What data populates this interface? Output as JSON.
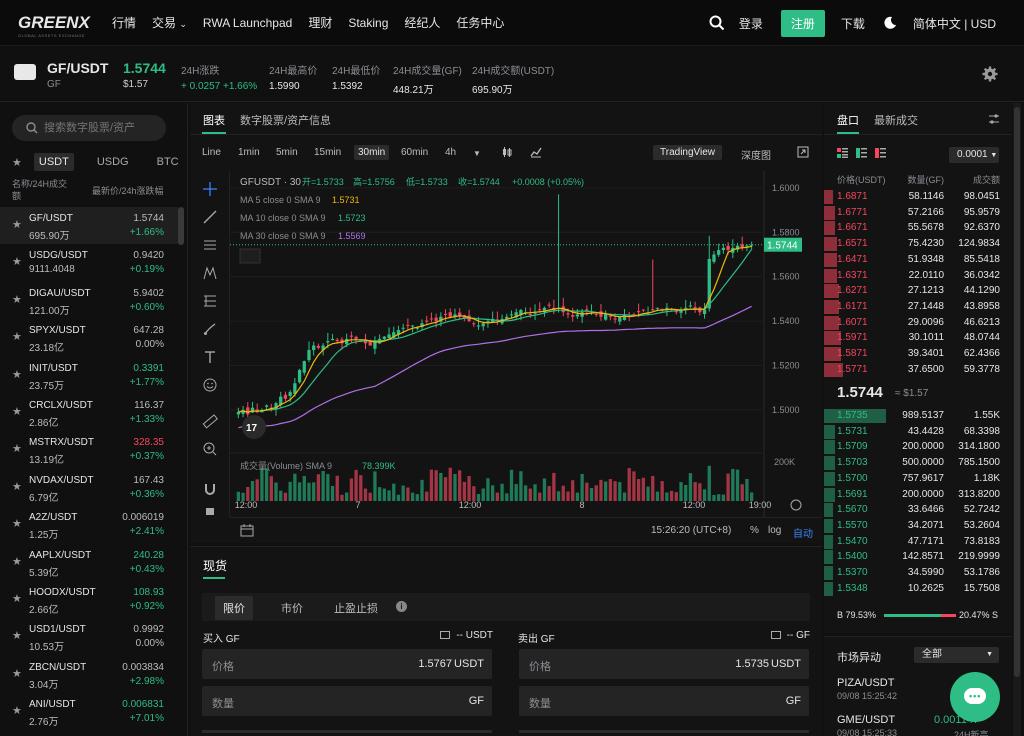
{
  "nav": {
    "logo": "GREENX",
    "logo_sub": "GLOBAL ASSETS EXCHANGE",
    "items": [
      "行情",
      "交易",
      "RWA Launchpad",
      "理财",
      "Staking",
      "经纪人",
      "任务中心"
    ],
    "login": "登录",
    "register": "注册",
    "download": "下载",
    "language": "简体中文 | USD"
  },
  "ticker": {
    "pair": "GF/USDT",
    "base": "GF",
    "last_price": "1.5744",
    "last_usd": "$1.57",
    "stats": [
      {
        "label": "24H涨跌",
        "value": "+ 0.0257 +1.66%",
        "color": "green"
      },
      {
        "label": "24H最高价",
        "value": "1.5990",
        "color": "white"
      },
      {
        "label": "24H最低价",
        "value": "1.5392",
        "color": "white"
      },
      {
        "label": "24H成交量(GF)",
        "value": "448.21万",
        "color": "white"
      },
      {
        "label": "24H成交额(USDT)",
        "value": "695.90万",
        "color": "white"
      }
    ]
  },
  "markets": {
    "search_placeholder": "搜索数字股票/资产",
    "tabs": [
      "USDT",
      "USDG",
      "BTC",
      "L"
    ],
    "head_left": "名称/24H成交额",
    "head_right": "最新价/24h涨跌幅",
    "rows": [
      {
        "symbol": "GF/USDT",
        "volume": "695.90万",
        "price": "1.5744",
        "change": "+1.66%",
        "price_color": "white",
        "change_color": "green"
      },
      {
        "symbol": "USDG/USDT",
        "volume": "9111.4048",
        "price": "0.9420",
        "change": "+0.19%",
        "price_color": "white",
        "change_color": "green"
      },
      {
        "symbol": "DIGAU/USDT",
        "volume": "121.00万",
        "price": "5.9402",
        "change": "+0.60%",
        "price_color": "white",
        "change_color": "green"
      },
      {
        "symbol": "SPYX/USDT",
        "volume": "23.18亿",
        "price": "647.28",
        "change": "0.00%",
        "price_color": "white",
        "change_color": "white"
      },
      {
        "symbol": "INIT/USDT",
        "volume": "23.75万",
        "price": "0.3391",
        "change": "+1.77%",
        "price_color": "green",
        "change_color": "green"
      },
      {
        "symbol": "CRCLX/USDT",
        "volume": "2.86亿",
        "price": "116.37",
        "change": "+1.33%",
        "price_color": "white",
        "change_color": "green"
      },
      {
        "symbol": "MSTRX/USDT",
        "volume": "13.19亿",
        "price": "328.35",
        "change": "+0.37%",
        "price_color": "red",
        "change_color": "green"
      },
      {
        "symbol": "NVDAX/USDT",
        "volume": "6.79亿",
        "price": "167.43",
        "change": "+0.36%",
        "price_color": "white",
        "change_color": "green"
      },
      {
        "symbol": "A2Z/USDT",
        "volume": "1.25万",
        "price": "0.006019",
        "change": "+2.41%",
        "price_color": "white",
        "change_color": "green"
      },
      {
        "symbol": "AAPLX/USDT",
        "volume": "5.39亿",
        "price": "240.28",
        "change": "+0.43%",
        "price_color": "green",
        "change_color": "green"
      },
      {
        "symbol": "HOODX/USDT",
        "volume": "2.66亿",
        "price": "108.93",
        "change": "+0.92%",
        "price_color": "green",
        "change_color": "green"
      },
      {
        "symbol": "USD1/USDT",
        "volume": "10.53万",
        "price": "0.9992",
        "change": "0.00%",
        "price_color": "white",
        "change_color": "white"
      },
      {
        "symbol": "ZBCN/USDT",
        "volume": "3.04万",
        "price": "0.003834",
        "change": "+2.98%",
        "price_color": "white",
        "change_color": "green"
      },
      {
        "symbol": "ANI/USDT",
        "volume": "2.76万",
        "price": "0.006831",
        "change": "+7.01%",
        "price_color": "green",
        "change_color": "green"
      }
    ]
  },
  "chart_tabs": [
    "图表",
    "数字股票/资产信息"
  ],
  "intervals": [
    "Line",
    "1min",
    "5min",
    "15min",
    "30min",
    "60min",
    "4h"
  ],
  "active_interval": "30min",
  "tradingview_label": "TradingView",
  "depth_label": "深度图",
  "chart_data": {
    "type": "candlestick",
    "header": "GFUSDT · 30",
    "ohlc_labels": {
      "open": "开=1.5733",
      "high": "高=1.5756",
      "low": "低=1.5733",
      "close": "收=1.5744",
      "change": "+0.0008 (+0.05%)"
    },
    "indicators": [
      {
        "label": "MA 5 close 0 SMA 9",
        "value": "1.5731",
        "color": "#f0b90b"
      },
      {
        "label": "MA 10 close 0 SMA 9",
        "value": "1.5723",
        "color": "#2ebd85"
      },
      {
        "label": "MA 30 close 0 SMA 9",
        "value": "1.5569",
        "color": "#b070e8"
      }
    ],
    "y_ticks": [
      "1.6000",
      "1.5800",
      "1.5600",
      "1.5400",
      "1.5200",
      "1.5000"
    ],
    "ylim": [
      1.486,
      1.604
    ],
    "price_tag": "1.5744",
    "x_ticks": [
      "12:00",
      "7",
      "12:00",
      "8",
      "12:00",
      "19:00"
    ],
    "volume_label": "成交量(Volume) SMA 9",
    "volume_value": "78.399K",
    "volume_tick": "200K",
    "close_path": [
      1.499,
      1.5,
      1.498,
      1.501,
      1.499,
      1.5,
      1.502,
      1.501,
      1.503,
      1.506,
      1.505,
      1.508,
      1.512,
      1.518,
      1.522,
      1.527,
      1.529,
      1.528,
      1.529,
      1.531,
      1.532,
      1.531,
      1.53,
      1.532,
      1.533,
      1.532,
      1.531,
      1.53,
      1.529,
      1.531,
      1.532,
      1.533,
      1.534,
      1.535,
      1.536,
      1.537,
      1.538,
      1.538,
      1.537,
      1.539,
      1.54,
      1.541,
      1.54,
      1.542,
      1.543,
      1.542,
      1.543,
      1.542,
      1.541,
      1.54,
      1.539,
      1.538,
      1.539,
      1.54,
      1.541,
      1.54,
      1.541,
      1.542,
      1.543,
      1.544,
      1.545,
      1.544,
      1.543,
      1.544,
      1.545,
      1.546,
      1.547,
      1.545,
      1.546,
      1.544,
      1.543,
      1.542,
      1.543,
      1.544,
      1.545,
      1.544,
      1.543,
      1.542,
      1.543,
      1.542,
      1.541,
      1.542,
      1.543,
      1.542,
      1.543,
      1.544,
      1.545,
      1.544,
      1.545,
      1.546,
      1.545,
      1.546,
      1.545,
      1.544,
      1.545,
      1.546,
      1.547,
      1.545,
      1.544,
      1.545,
      1.568,
      1.57,
      1.572,
      1.573,
      1.572,
      1.573,
      1.574,
      1.573,
      1.574,
      1.5744
    ]
  },
  "chart_footer": {
    "time": "15:26:20 (UTC+8)",
    "pct": "%",
    "log": "log",
    "auto": "自动"
  },
  "order": {
    "spot_tab": "现货",
    "types": [
      "限价",
      "市价",
      "止盈止损"
    ],
    "buy_title": "买入 GF",
    "sell_title": "卖出 GF",
    "buy_balance": "-- USDT",
    "sell_balance": "-- GF",
    "price_label": "价格",
    "qty_label": "数量",
    "buy_price": "1.5767",
    "sell_price": "1.5735",
    "price_unit": "USDT",
    "qty_unit": "GF"
  },
  "book": {
    "tabs": [
      "盘口",
      "最新成交"
    ],
    "precision": "0.0001",
    "head": [
      "价格(USDT)",
      "数量(GF)",
      "成交额"
    ],
    "asks": [
      [
        "1.6871",
        "58.1146",
        "98.0451"
      ],
      [
        "1.6771",
        "57.2166",
        "95.9579"
      ],
      [
        "1.6671",
        "55.5678",
        "92.6370"
      ],
      [
        "1.6571",
        "75.4230",
        "124.9834"
      ],
      [
        "1.6471",
        "51.9348",
        "85.5418"
      ],
      [
        "1.6371",
        "22.0110",
        "36.0342"
      ],
      [
        "1.6271",
        "27.1213",
        "44.1290"
      ],
      [
        "1.6171",
        "27.1448",
        "43.8958"
      ],
      [
        "1.6071",
        "29.0096",
        "46.6213"
      ],
      [
        "1.5971",
        "30.1011",
        "48.0744"
      ],
      [
        "1.5871",
        "39.3401",
        "62.4366"
      ],
      [
        "1.5771",
        "37.6500",
        "59.3778"
      ]
    ],
    "ask_depth": [
      0.05,
      0.06,
      0.06,
      0.07,
      0.07,
      0.07,
      0.08,
      0.08,
      0.08,
      0.09,
      0.09,
      0.1
    ],
    "mid_price": "1.5744",
    "mid_usd": "≈ $1.57",
    "bids": [
      [
        "1.5735",
        "989.5137",
        "1.55K"
      ],
      [
        "1.5731",
        "43.4428",
        "68.3398"
      ],
      [
        "1.5709",
        "200.0000",
        "314.1800"
      ],
      [
        "1.5703",
        "500.0000",
        "785.1500"
      ],
      [
        "1.5700",
        "757.9617",
        "1.18K"
      ],
      [
        "1.5691",
        "200.0000",
        "313.8200"
      ],
      [
        "1.5670",
        "33.6466",
        "52.7242"
      ],
      [
        "1.5570",
        "34.2071",
        "53.2604"
      ],
      [
        "1.5470",
        "47.7171",
        "73.8183"
      ],
      [
        "1.5400",
        "142.8571",
        "219.9999"
      ],
      [
        "1.5370",
        "34.5990",
        "53.1786"
      ],
      [
        "1.5348",
        "10.2625",
        "15.7508"
      ]
    ],
    "bid_depth": [
      0.33,
      0.06,
      0.06,
      0.06,
      0.06,
      0.06,
      0.05,
      0.05,
      0.05,
      0.05,
      0.05,
      0.05
    ],
    "buy_ratio": "B 79.53%",
    "sell_ratio": "20.47% S",
    "buy_ratio_value": 79.53
  },
  "movers": {
    "title": "市场异动",
    "filter": "全部",
    "items": [
      {
        "symbol": "PIZA/USDT",
        "time": "09/08 15:25:42",
        "value": ""
      },
      {
        "symbol": "GME/USDT",
        "time": "09/08 15:25:33",
        "value": "0.001147",
        "tag": "24H新高"
      }
    ]
  },
  "colors": {
    "accent": "#2ebd85",
    "down": "#f6465d",
    "bg": "#101010",
    "panel": "#131313"
  }
}
